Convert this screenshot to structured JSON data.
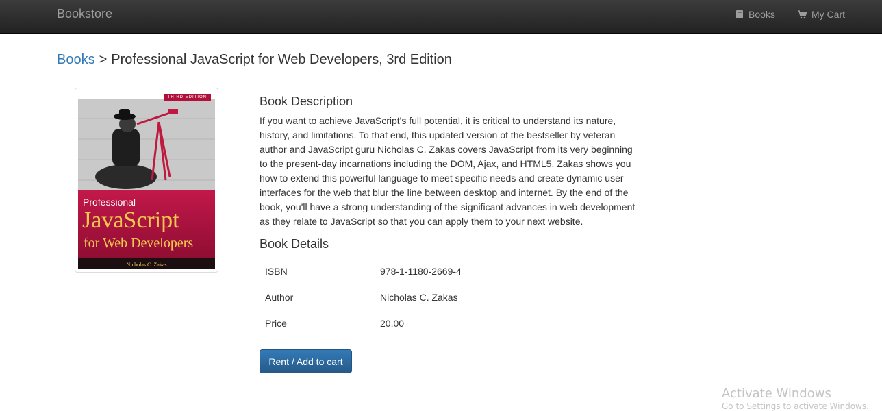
{
  "navbar": {
    "brand": "Bookstore",
    "links": [
      {
        "label": "Books",
        "icon": "book-icon"
      },
      {
        "label": "My Cart",
        "icon": "cart-icon"
      }
    ]
  },
  "breadcrumb": {
    "root": "Books",
    "separator": ">",
    "current": "Professional JavaScript for Web Developers, 3rd Edition"
  },
  "cover": {
    "edition": "THIRD EDITION",
    "line1": "Professional",
    "line2": "JavaScript",
    "line3": "for Web Developers",
    "author": "Nicholas C. Zakas"
  },
  "description": {
    "title": "Book Description",
    "text": "If you want to achieve JavaScript's full potential, it is critical to understand its nature, history, and limitations. To that end, this updated version of the bestseller by veteran author and JavaScript guru Nicholas C. Zakas covers JavaScript from its very beginning to the present-day incarnations including the DOM, Ajax, and HTML5. Zakas shows you how to extend this powerful language to meet specific needs and create dynamic user interfaces for the web that blur the line between desktop and internet. By the end of the book, you'll have a strong understanding of the significant advances in web development as they relate to JavaScript so that you can apply them to your next website."
  },
  "details": {
    "title": "Book Details",
    "rows": [
      {
        "key": "ISBN",
        "value": "978-1-1180-2669-4"
      },
      {
        "key": "Author",
        "value": "Nicholas C. Zakas"
      },
      {
        "key": "Price",
        "value": "20.00"
      }
    ]
  },
  "actions": {
    "rent_label": "Rent / Add to cart"
  },
  "watermark": {
    "title": "Activate Windows",
    "subtitle": "Go to Settings to activate Windows."
  },
  "colors": {
    "navbar": "#222222",
    "link": "#337ab7",
    "button": "#337ab7"
  }
}
